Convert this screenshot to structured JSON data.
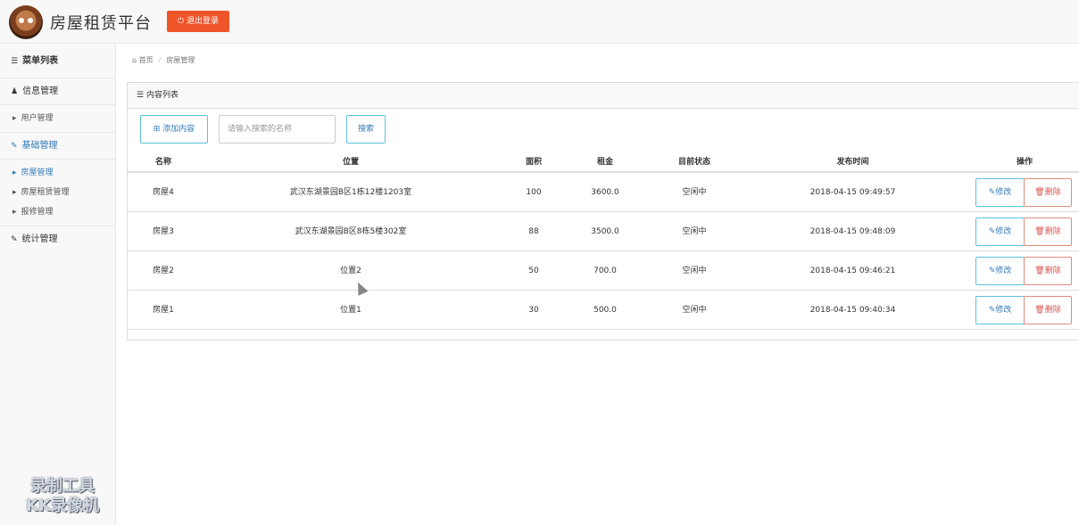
{
  "header": {
    "brand": "房屋租赁平台",
    "logout_label": "退出登录",
    "logout_icon": "power-icon",
    "accent_color": "#f0552a"
  },
  "sidebar": {
    "title": "菜单列表",
    "groups": [
      {
        "label": "信息管理",
        "icon": "user-icon",
        "items": [
          "用户管理"
        ]
      },
      {
        "label": "基础管理",
        "icon": "edit-icon",
        "active": true,
        "items": [
          "房屋管理",
          "房屋租赁管理",
          "报修管理"
        ]
      },
      {
        "label": "统计管理",
        "icon": "edit-icon",
        "items": []
      }
    ],
    "watermark": [
      "录制工具",
      "KK录像机"
    ]
  },
  "breadcrumb": {
    "home": "首页",
    "current": "房屋管理"
  },
  "panel": {
    "title": "内容列表",
    "add_label": "添加内容",
    "search_placeholder": "请输入搜索的名称",
    "search_label": "搜索"
  },
  "table": {
    "headers": [
      "名称",
      "位置",
      "面积",
      "租金",
      "目前状态",
      "发布时间",
      "操作"
    ],
    "rows": [
      {
        "name": "房屋4",
        "location": "武汉东湖景园B区1栋12楼1203室",
        "area": "100",
        "rent": "3600.0",
        "status": "空闲中",
        "time": "2018-04-15 09:49:57"
      },
      {
        "name": "房屋3",
        "location": "武汉东湖景园B区8栋5楼302室",
        "area": "88",
        "rent": "3500.0",
        "status": "空闲中",
        "time": "2018-04-15 09:48:09"
      },
      {
        "name": "房屋2",
        "location": "位置2",
        "area": "50",
        "rent": "700.0",
        "status": "空闲中",
        "time": "2018-04-15 09:46:21"
      },
      {
        "name": "房屋1",
        "location": "位置1",
        "area": "30",
        "rent": "500.0",
        "status": "空闲中",
        "time": "2018-04-15 09:40:34"
      }
    ],
    "edit_label": "修改",
    "delete_label": "删除"
  }
}
